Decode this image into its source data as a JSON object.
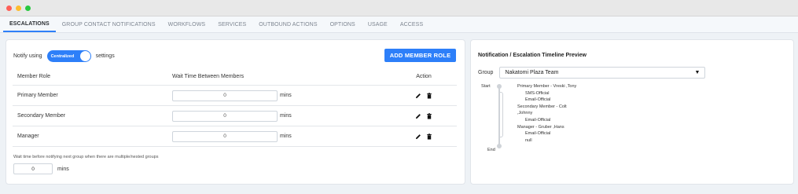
{
  "tabs": [
    {
      "label": "ESCALATIONS",
      "active": true
    },
    {
      "label": "GROUP CONTACT NOTIFICATIONS"
    },
    {
      "label": "WORKFLOWS"
    },
    {
      "label": "SERVICES"
    },
    {
      "label": "OUTBOUND ACTIONS"
    },
    {
      "label": "OPTIONS"
    },
    {
      "label": "USAGE"
    },
    {
      "label": "ACCESS"
    }
  ],
  "escalation": {
    "notify_prefix": "Notify using",
    "toggle_label": "Centralized",
    "notify_suffix": "settings",
    "add_member_role": "ADD MEMBER ROLE",
    "headers": {
      "role": "Member Role",
      "wait": "Wait Time Between Members",
      "action": "Action"
    },
    "rows": [
      {
        "role": "Primary Member",
        "wait": "0",
        "unit": "mins"
      },
      {
        "role": "Secondary Member",
        "wait": "0",
        "unit": "mins"
      },
      {
        "role": "Manager",
        "wait": "0",
        "unit": "mins"
      }
    ],
    "group_wait_note": "Wait time before notifying next group when there are multiple/nested groups",
    "group_wait_value": "0",
    "group_wait_unit": "mins"
  },
  "preview": {
    "title": "Notification / Escalation Timeline Preview",
    "group_label": "Group",
    "group_value": "Nakatomi Plaza Team",
    "start_label": "Start",
    "end_label": "End",
    "entries": [
      {
        "text": "Primary Member - Vreski ,Tony",
        "indent": false
      },
      {
        "text": "SMS-Official",
        "indent": true
      },
      {
        "text": "Email-Official",
        "indent": true
      },
      {
        "text": "Secondary Member - Colt",
        "indent": false
      },
      {
        "text": ",Johnny",
        "indent": false
      },
      {
        "text": "Email-Official",
        "indent": true
      },
      {
        "text": "Manager - Gruber ,Hans",
        "indent": false
      },
      {
        "text": "Email-Official",
        "indent": true
      },
      {
        "text": "null",
        "indent": true
      }
    ]
  },
  "colors": {
    "accent": "#2d7ff9"
  },
  "icons": {
    "edit": "pencil-icon",
    "delete": "trash-icon",
    "dropdown": "caret-down-icon"
  }
}
